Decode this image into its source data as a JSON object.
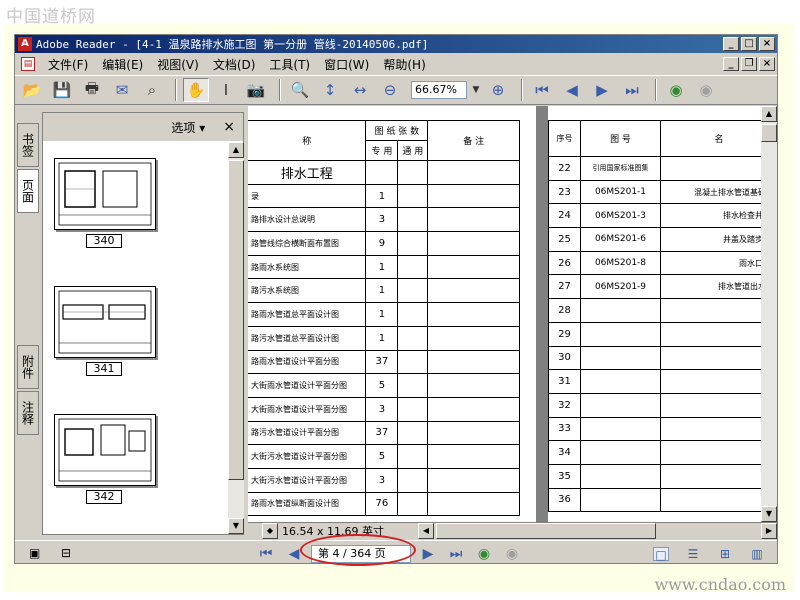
{
  "watermarks": {
    "top": "中国道桥网",
    "bottom": "www.cndao.com"
  },
  "window": {
    "title": "Adobe Reader - [4-1 温泉路排水施工图 第一分册 管线-20140506.pdf]"
  },
  "menu": [
    "文件(F)",
    "编辑(E)",
    "视图(V)",
    "文档(D)",
    "工具(T)",
    "窗口(W)",
    "帮助(H)"
  ],
  "toolbar": {
    "zoom_value": "66.67%"
  },
  "left_tabs": {
    "bookmarks": "书签",
    "pages": "页面",
    "attachments": "附件",
    "comments": "注释"
  },
  "panel": {
    "options_label": "选项 ▾",
    "close_label": "×"
  },
  "thumbnails": [
    {
      "number": "340"
    },
    {
      "number": "341"
    },
    {
      "number": "342"
    }
  ],
  "document": {
    "left_table": {
      "headers": {
        "name": "称",
        "sheets": "图 纸 张 数",
        "dedicated": "专 用",
        "general": "通 用",
        "remark": "备 注"
      },
      "section_title": "排水工程",
      "rows": [
        {
          "name": "录",
          "count": "1"
        },
        {
          "name": "路排水设计总说明",
          "count": "3"
        },
        {
          "name": "路管线综合横断面布置图",
          "count": "9"
        },
        {
          "name": "路雨水系统图",
          "count": "1"
        },
        {
          "name": "路污水系统图",
          "count": "1"
        },
        {
          "name": "路雨水管道总平面设计图",
          "count": "1"
        },
        {
          "name": "路污水管道总平面设计图",
          "count": "1"
        },
        {
          "name": "路雨水管道设计平面分图",
          "count": "37"
        },
        {
          "name": "大街雨水管道设计平面分图",
          "count": "5"
        },
        {
          "name": "大街雨水管道设计平面分图",
          "count": "3"
        },
        {
          "name": "路污水管道设计平面分图",
          "count": "37"
        },
        {
          "name": "大街污水管道设计平面分图",
          "count": "5"
        },
        {
          "name": "大街污水管道设计平面分图",
          "count": "3"
        },
        {
          "name": "路雨水管道纵断面设计图",
          "count": "76"
        }
      ]
    },
    "right_table": {
      "headers": {
        "seq": "序号",
        "drawing_no": "图 号",
        "name": "名"
      },
      "rows": [
        {
          "seq": "22",
          "code": "引用国家标准图集",
          "name": ""
        },
        {
          "seq": "23",
          "code": "06MS201-1",
          "name": "混凝土排水管道基础及"
        },
        {
          "seq": "24",
          "code": "06MS201-3",
          "name": "排水检查井"
        },
        {
          "seq": "25",
          "code": "06MS201-6",
          "name": "井盖及踏步"
        },
        {
          "seq": "26",
          "code": "06MS201-8",
          "name": "雨水口"
        },
        {
          "seq": "27",
          "code": "06MS201-9",
          "name": "排水管道出水口"
        },
        {
          "seq": "28",
          "code": "",
          "name": ""
        },
        {
          "seq": "29",
          "code": "",
          "name": ""
        },
        {
          "seq": "30",
          "code": "",
          "name": ""
        },
        {
          "seq": "31",
          "code": "",
          "name": ""
        },
        {
          "seq": "32",
          "code": "",
          "name": ""
        },
        {
          "seq": "33",
          "code": "",
          "name": ""
        },
        {
          "seq": "34",
          "code": "",
          "name": ""
        },
        {
          "seq": "35",
          "code": "",
          "name": ""
        },
        {
          "seq": "36",
          "code": "",
          "name": ""
        }
      ]
    }
  },
  "page_size": "16.54 x 11.69 英寸",
  "status": {
    "page_indicator": "第 4 / 364 页"
  },
  "colors": {
    "title_bar": "#0a246a",
    "annotation_ellipse": "#d42020"
  }
}
